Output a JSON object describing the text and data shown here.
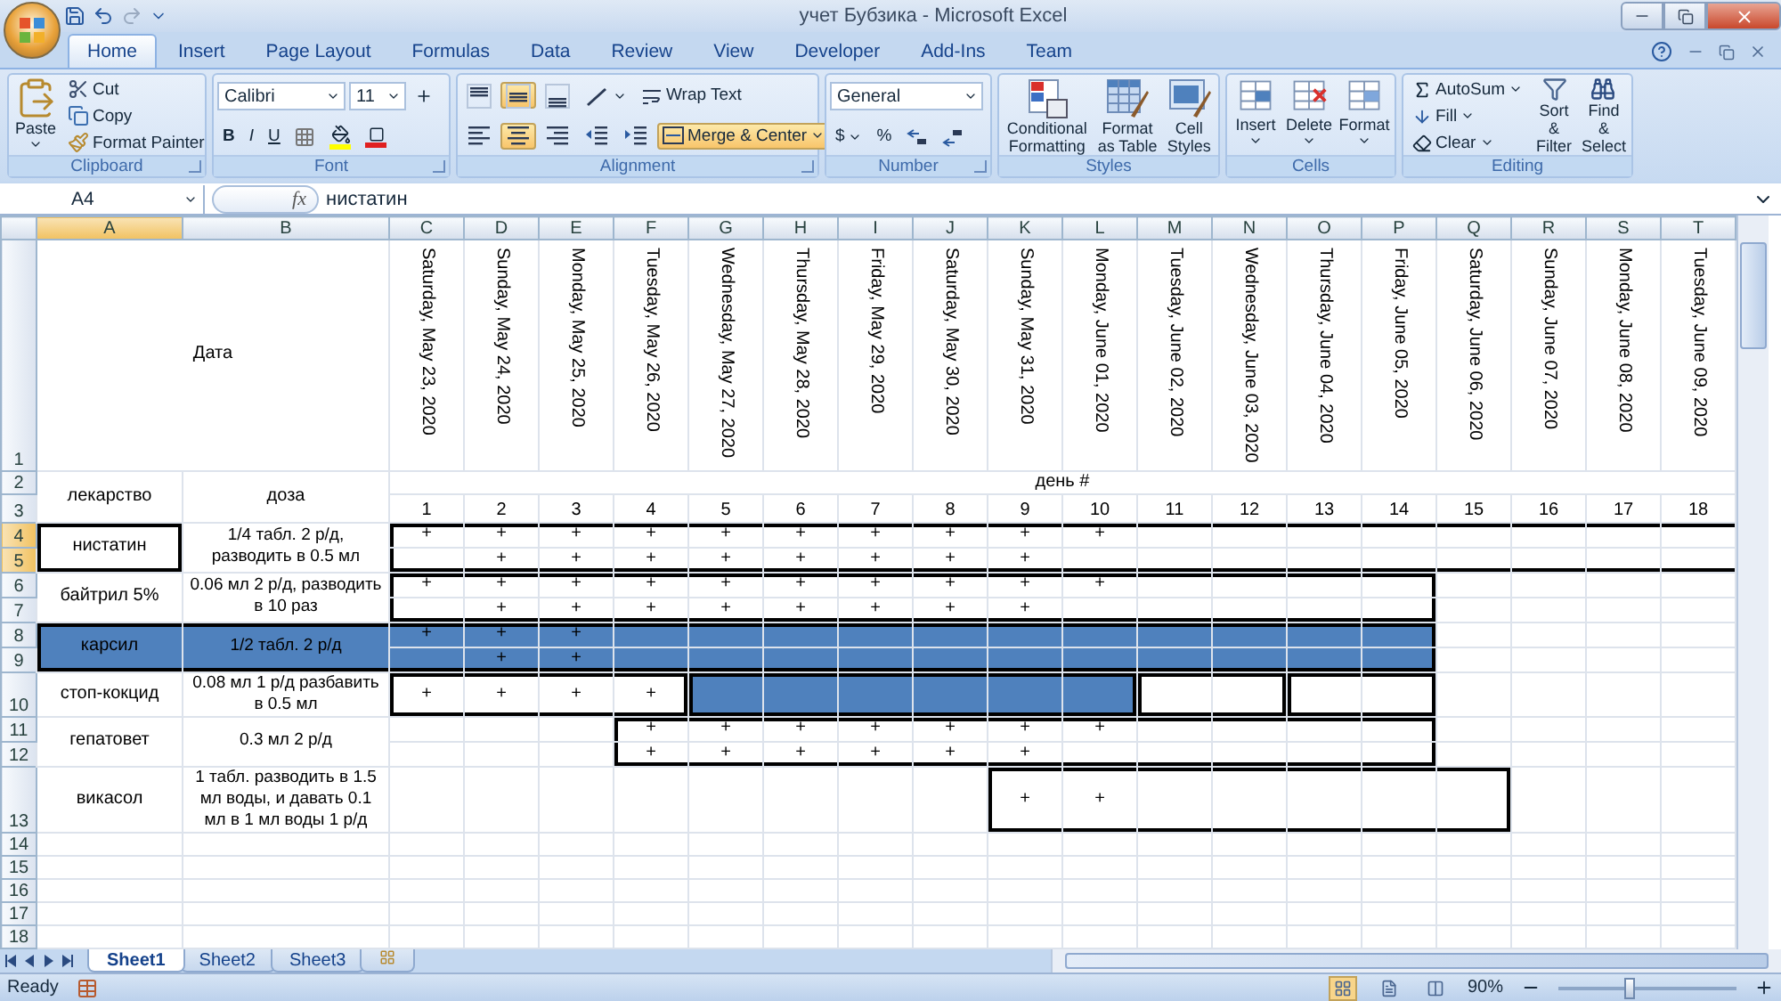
{
  "title_bar": {
    "title": "учет Бубзика - Microsoft Excel"
  },
  "tabs": [
    {
      "label": "Home",
      "selected": true
    },
    {
      "label": "Insert",
      "selected": false
    },
    {
      "label": "Page Layout",
      "selected": false
    },
    {
      "label": "Formulas",
      "selected": false
    },
    {
      "label": "Data",
      "selected": false
    },
    {
      "label": "Review",
      "selected": false
    },
    {
      "label": "View",
      "selected": false
    },
    {
      "label": "Developer",
      "selected": false
    },
    {
      "label": "Add-Ins",
      "selected": false
    },
    {
      "label": "Team",
      "selected": false
    }
  ],
  "ribbon": {
    "clipboard": {
      "label": "Clipboard",
      "paste": "Paste",
      "cut": "Cut",
      "copy": "Copy",
      "format_painter": "Format Painter"
    },
    "font": {
      "label": "Font",
      "font_name": "Calibri",
      "font_size": "11",
      "bold": "B",
      "italic": "I",
      "underline": "U"
    },
    "alignment": {
      "label": "Alignment",
      "buttons": [
        {
          "kind": "top",
          "on": false
        },
        {
          "kind": "middle",
          "on": true
        },
        {
          "kind": "bottom",
          "on": false
        },
        {
          "kind": "left",
          "on": false
        },
        {
          "kind": "center",
          "on": true
        },
        {
          "kind": "right",
          "on": false
        }
      ],
      "wrap_text": {
        "label": "Wrap Text",
        "on": false
      },
      "merge_center": {
        "label": "Merge & Center",
        "on": true
      }
    },
    "number": {
      "label": "Number",
      "format": "General",
      "currency": "$",
      "percent": "%"
    },
    "styles": {
      "label": "Styles",
      "buttons": [
        {
          "kind": "conditional",
          "label": "Conditional Formatting"
        },
        {
          "kind": "table",
          "label": "Format as Table"
        },
        {
          "kind": "cell",
          "label": "Cell Styles"
        }
      ]
    },
    "cells": {
      "label": "Cells",
      "buttons": [
        {
          "kind": "insert",
          "label": "Insert"
        },
        {
          "kind": "delete",
          "label": "Delete"
        },
        {
          "kind": "format",
          "label": "Format"
        }
      ]
    },
    "editing": {
      "label": "Editing",
      "autosum": "AutoSum",
      "fill": "Fill",
      "clear": "Clear",
      "sort_filter": "Sort & Filter",
      "find_select": "Find & Select"
    }
  },
  "formula_bar": {
    "name_box": "A4",
    "fx": "fx",
    "formula": "нистатин"
  },
  "sheet": {
    "columns": [
      {
        "label": "A",
        "selected": true
      },
      {
        "label": "B",
        "selected": false
      },
      {
        "label": "C",
        "selected": false
      },
      {
        "label": "D",
        "selected": false
      },
      {
        "label": "E",
        "selected": false
      },
      {
        "label": "F",
        "selected": false
      },
      {
        "label": "G",
        "selected": false
      },
      {
        "label": "H",
        "selected": false
      },
      {
        "label": "I",
        "selected": false
      },
      {
        "label": "J",
        "selected": false
      },
      {
        "label": "K",
        "selected": false
      },
      {
        "label": "L",
        "selected": false
      },
      {
        "label": "M",
        "selected": false
      },
      {
        "label": "N",
        "selected": false
      },
      {
        "label": "O",
        "selected": false
      },
      {
        "label": "P",
        "selected": false
      },
      {
        "label": "Q",
        "selected": false
      },
      {
        "label": "R",
        "selected": false
      },
      {
        "label": "S",
        "selected": false
      },
      {
        "label": "T",
        "selected": false
      }
    ],
    "header_rows": [
      "1",
      "2",
      "3"
    ],
    "date_label": "Дата",
    "dates": [
      "Saturday, May 23, 2020",
      "Sunday, May 24, 2020",
      "Monday, May 25, 2020",
      "Tuesday, May 26, 2020",
      "Wednesday, May 27, 2020",
      "Thursday, May 28, 2020",
      "Friday, May 29, 2020",
      "Saturday, May 30, 2020",
      "Sunday, May 31, 2020",
      "Monday, June 01, 2020",
      "Tuesday, June 02, 2020",
      "Wednesday, June 03, 2020",
      "Thursday, June 04, 2020",
      "Friday, June 05, 2020",
      "Saturday, June 06, 2020",
      "Sunday, June 07, 2020",
      "Monday, June 08, 2020",
      "Tuesday, June 09, 2020"
    ],
    "drug_label": "лекарство",
    "dose_label": "доза",
    "day_label": "день #",
    "day_numbers": [
      "1",
      "2",
      "3",
      "4",
      "5",
      "6",
      "7",
      "8",
      "9",
      "10",
      "11",
      "12",
      "13",
      "14",
      "15",
      "16",
      "17",
      "18"
    ],
    "drugs": [
      {
        "name": "нистатин",
        "dose": "1/4 табл. 2 р/д, разводить в 0.5 мл",
        "selected": true,
        "label_shaded": false,
        "label_framed": false,
        "rows": [
          {
            "label": "4",
            "selected": true
          },
          {
            "label": "5",
            "selected": true
          }
        ],
        "days": [
          {
            "first_row": "+",
            "frame_start": true,
            "frame_end": false,
            "shaded": false
          },
          {
            "first_row": "+",
            "second_row": "+",
            "frame_start": false,
            "frame_end": false,
            "shaded": false
          },
          {
            "first_row": "+",
            "second_row": "+",
            "frame_start": false,
            "frame_end": false,
            "shaded": false
          },
          {
            "first_row": "+",
            "second_row": "+",
            "frame_start": false,
            "frame_end": false,
            "shaded": false
          },
          {
            "first_row": "+",
            "second_row": "+",
            "frame_start": false,
            "frame_end": false,
            "shaded": false
          },
          {
            "first_row": "+",
            "second_row": "+",
            "frame_start": false,
            "frame_end": false,
            "shaded": false
          },
          {
            "first_row": "+",
            "second_row": "+",
            "frame_start": false,
            "frame_end": false,
            "shaded": false
          },
          {
            "first_row": "+",
            "second_row": "+",
            "frame_start": false,
            "frame_end": false,
            "shaded": false
          },
          {
            "first_row": "+",
            "second_row": "+",
            "frame_start": false,
            "frame_end": false,
            "shaded": false
          },
          {
            "first_row": "+",
            "frame_start": false,
            "frame_end": false,
            "shaded": false
          },
          {
            "frame_start": false,
            "frame_end": false,
            "shaded": false
          },
          {
            "frame_start": false,
            "frame_end": false,
            "shaded": false
          },
          {
            "frame_start": false,
            "frame_end": false,
            "shaded": false
          },
          {
            "frame_start": false,
            "frame_end": false,
            "shaded": false
          },
          {
            "frame_start": false,
            "frame_end": false,
            "shaded": false
          },
          {
            "frame_start": false,
            "frame_end": false,
            "shaded": false
          },
          {
            "frame_start": false,
            "frame_end": false,
            "shaded": false
          },
          {
            "frame_start": false,
            "frame_end": false,
            "shaded": false
          }
        ]
      },
      {
        "name": "байтрил 5%",
        "dose": "0.06 мл 2 р/д, разводить в 10 раз",
        "selected": false,
        "label_shaded": false,
        "label_framed": false,
        "rows": [
          {
            "label": "6",
            "selected": false
          },
          {
            "label": "7",
            "selected": false
          }
        ],
        "days": [
          {
            "first_row": "+",
            "frame_start": true,
            "frame_end": false,
            "shaded": false
          },
          {
            "first_row": "+",
            "second_row": "+",
            "frame_start": false,
            "frame_end": false,
            "shaded": false
          },
          {
            "first_row": "+",
            "second_row": "+",
            "frame_start": false,
            "frame_end": false,
            "shaded": false
          },
          {
            "first_row": "+",
            "second_row": "+",
            "frame_start": false,
            "frame_end": false,
            "shaded": false
          },
          {
            "first_row": "+",
            "second_row": "+",
            "frame_start": false,
            "frame_end": false,
            "shaded": false
          },
          {
            "first_row": "+",
            "second_row": "+",
            "frame_start": false,
            "frame_end": false,
            "shaded": false
          },
          {
            "first_row": "+",
            "second_row": "+",
            "frame_start": false,
            "frame_end": false,
            "shaded": false
          },
          {
            "first_row": "+",
            "second_row": "+",
            "frame_start": false,
            "frame_end": false,
            "shaded": false
          },
          {
            "first_row": "+",
            "second_row": "+",
            "frame_start": false,
            "frame_end": false,
            "shaded": false
          },
          {
            "first_row": "+",
            "frame_start": false,
            "frame_end": false,
            "shaded": false
          },
          {
            "frame_start": false,
            "frame_end": false,
            "shaded": false
          },
          {
            "frame_start": false,
            "frame_end": false,
            "shaded": false
          },
          {
            "frame_start": false,
            "frame_end": false,
            "shaded": false
          },
          {
            "frame_start": false,
            "frame_end": true,
            "shaded": false
          }
        ]
      },
      {
        "name": "карсил",
        "dose": "1/2 табл. 2 р/д",
        "selected": false,
        "label_shaded": true,
        "label_framed": true,
        "rows": [
          {
            "label": "8",
            "selected": false
          },
          {
            "label": "9",
            "selected": false
          }
        ],
        "days": [
          {
            "first_row": "+",
            "frame_start": false,
            "frame_end": false,
            "shaded": true
          },
          {
            "first_row": "+",
            "second_row": "+",
            "frame_start": false,
            "frame_end": false,
            "shaded": true
          },
          {
            "first_row": "+",
            "second_row": "+",
            "frame_start": false,
            "frame_end": false,
            "shaded": true
          },
          {
            "frame_start": false,
            "frame_end": false,
            "shaded": true
          },
          {
            "frame_start": false,
            "frame_end": false,
            "shaded": true
          },
          {
            "frame_start": false,
            "frame_end": false,
            "shaded": true
          },
          {
            "frame_start": false,
            "frame_end": false,
            "shaded": true
          },
          {
            "frame_start": false,
            "frame_end": false,
            "shaded": true
          },
          {
            "frame_start": false,
            "frame_end": false,
            "shaded": true
          },
          {
            "frame_start": false,
            "frame_end": false,
            "shaded": true
          },
          {
            "frame_start": false,
            "frame_end": false,
            "shaded": true
          },
          {
            "frame_start": false,
            "frame_end": false,
            "shaded": true
          },
          {
            "frame_start": false,
            "frame_end": false,
            "shaded": true
          },
          {
            "frame_start": false,
            "frame_end": true,
            "shaded": true
          }
        ]
      },
      {
        "name": "стоп-кокцид",
        "dose": "0.08 мл 1 р/д разбавить в 0.5 мл",
        "selected": false,
        "label_shaded": false,
        "label_framed": false,
        "rows": [
          {
            "label": "10",
            "selected": false
          }
        ],
        "days": [
          {
            "first_row": "+",
            "frame_start": true,
            "frame_end": false,
            "shaded": false
          },
          {
            "first_row": "+",
            "frame_start": false,
            "frame_end": false,
            "shaded": false
          },
          {
            "first_row": "+",
            "frame_start": false,
            "frame_end": false,
            "shaded": false
          },
          {
            "first_row": "+",
            "frame_start": false,
            "frame_end": true,
            "shaded": false
          },
          {
            "frame_start": true,
            "frame_end": false,
            "shaded": true
          },
          {
            "frame_start": false,
            "frame_end": false,
            "shaded": true
          },
          {
            "frame_start": false,
            "frame_end": false,
            "shaded": true
          },
          {
            "frame_start": false,
            "frame_end": false,
            "shaded": true
          },
          {
            "frame_start": false,
            "frame_end": false,
            "shaded": true
          },
          {
            "frame_start": false,
            "frame_end": true,
            "shaded": true
          },
          {
            "frame_start": true,
            "frame_end": false,
            "shaded": false
          },
          {
            "frame_start": false,
            "frame_end": true,
            "shaded": false
          },
          {
            "frame_start": true,
            "frame_end": false,
            "shaded": false
          },
          {
            "frame_start": false,
            "frame_end": true,
            "shaded": false
          }
        ]
      },
      {
        "name": "гепатовет",
        "dose": "0.3 мл 2 р/д",
        "selected": false,
        "label_shaded": false,
        "label_framed": false,
        "rows": [
          {
            "label": "11",
            "selected": false
          },
          {
            "label": "12",
            "selected": false
          }
        ],
        "days": [
          {
            "frame_start": false,
            "frame_end": false,
            "shaded": false
          },
          {
            "frame_start": false,
            "frame_end": false,
            "shaded": false
          },
          {
            "frame_start": false,
            "frame_end": false,
            "shaded": false
          },
          {
            "first_row": "+",
            "second_row": "+",
            "frame_start": true,
            "frame_end": false,
            "shaded": false
          },
          {
            "first_row": "+",
            "second_row": "+",
            "frame_start": false,
            "frame_end": false,
            "shaded": false
          },
          {
            "first_row": "+",
            "second_row": "+",
            "frame_start": false,
            "frame_end": false,
            "shaded": false
          },
          {
            "first_row": "+",
            "second_row": "+",
            "frame_start": false,
            "frame_end": false,
            "shaded": false
          },
          {
            "first_row": "+",
            "second_row": "+",
            "frame_start": false,
            "frame_end": false,
            "shaded": false
          },
          {
            "first_row": "+",
            "second_row": "+",
            "frame_start": false,
            "frame_end": false,
            "shaded": false
          },
          {
            "first_row": "+",
            "frame_start": false,
            "frame_end": false,
            "shaded": false
          },
          {
            "frame_start": false,
            "frame_end": false,
            "shaded": false
          },
          {
            "frame_start": false,
            "frame_end": false,
            "shaded": false
          },
          {
            "frame_start": false,
            "frame_end": false,
            "shaded": false
          },
          {
            "frame_start": false,
            "frame_end": true,
            "shaded": false
          }
        ]
      },
      {
        "name": "викасол",
        "dose": "1 табл. разводить в 1.5 мл воды, и давать 0.1 мл  в 1 мл воды  1 р/д",
        "selected": false,
        "label_shaded": false,
        "label_framed": false,
        "rows": [
          {
            "label": "13",
            "selected": false
          }
        ],
        "days": [
          {
            "frame_start": false,
            "frame_end": false,
            "shaded": false
          },
          {
            "frame_start": false,
            "frame_end": false,
            "shaded": false
          },
          {
            "frame_start": false,
            "frame_end": false,
            "shaded": false
          },
          {
            "frame_start": false,
            "frame_end": false,
            "shaded": false
          },
          {
            "frame_start": false,
            "frame_end": false,
            "shaded": false
          },
          {
            "frame_start": false,
            "frame_end": false,
            "shaded": false
          },
          {
            "frame_start": false,
            "frame_end": false,
            "shaded": false
          },
          {
            "frame_start": false,
            "frame_end": false,
            "shaded": false
          },
          {
            "first_row": "+",
            "frame_start": true,
            "frame_end": false,
            "shaded": false
          },
          {
            "first_row": "+",
            "frame_start": false,
            "frame_end": false,
            "shaded": false
          },
          {
            "frame_start": false,
            "frame_end": false,
            "shaded": false
          },
          {
            "frame_start": false,
            "frame_end": false,
            "shaded": false
          },
          {
            "frame_start": false,
            "frame_end": false,
            "shaded": false
          },
          {
            "frame_start": false,
            "frame_end": false,
            "shaded": false
          },
          {
            "frame_start": false,
            "frame_end": true,
            "shaded": false
          }
        ]
      }
    ],
    "empty_rows": [
      "14",
      "15",
      "16",
      "17",
      "18"
    ]
  },
  "sheet_tabs": [
    {
      "label": "Sheet1",
      "selected": true
    },
    {
      "label": "Sheet2",
      "selected": false
    },
    {
      "label": "Sheet3",
      "selected": false
    }
  ],
  "status_bar": {
    "status": "Ready",
    "zoom": "90%",
    "zoom_slider": {
      "level": 0.4
    }
  }
}
